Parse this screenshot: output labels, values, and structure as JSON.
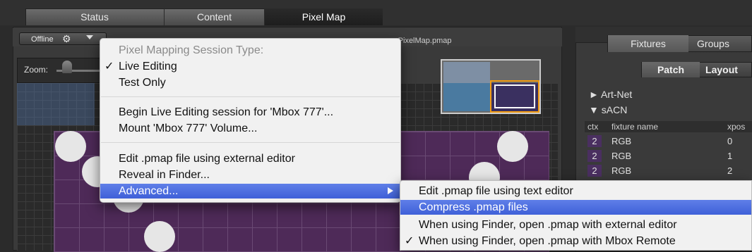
{
  "tabs": [
    {
      "label": "Status"
    },
    {
      "label": "Content"
    },
    {
      "label": "Pixel Map"
    }
  ],
  "toolbar": {
    "offline_label": "Offline",
    "gear_icon": "gear-icon",
    "filename_fragment": "rPixelMap.pmap"
  },
  "zoom": {
    "label": "Zoom:"
  },
  "right_panel": {
    "tabs": [
      "Fixtures",
      "Groups"
    ],
    "subtabs": [
      "Patch",
      "Layout"
    ],
    "tree": [
      {
        "arrow": "►",
        "label": "Art-Net"
      },
      {
        "arrow": "▼",
        "label": "sACN"
      }
    ],
    "columns": [
      "ctx",
      "fixture name",
      "xpos"
    ],
    "rows": [
      {
        "ctx": "2",
        "name": "RGB",
        "xpos": "0"
      },
      {
        "ctx": "2",
        "name": "RGB",
        "xpos": "1"
      },
      {
        "ctx": "2",
        "name": "RGB",
        "xpos": "2"
      }
    ]
  },
  "menu": {
    "header": "Pixel Mapping Session Type:",
    "items": [
      {
        "label": "Live Editing",
        "checked": "✓"
      },
      {
        "label": "Test Only",
        "checked": ""
      },
      {
        "label": "Begin Live Editing session for 'Mbox 777'..."
      },
      {
        "label": "Mount 'Mbox 777' Volume..."
      },
      {
        "label": "Edit .pmap file using external editor"
      },
      {
        "label": "Reveal in Finder..."
      },
      {
        "label": "Advanced..."
      }
    ]
  },
  "submenu": {
    "items": [
      {
        "label": "Edit .pmap file using text editor",
        "checked": ""
      },
      {
        "label": "Compress .pmap files",
        "checked": ""
      },
      {
        "label": "When using Finder, open .pmap with external editor",
        "checked": ""
      },
      {
        "label": "When using Finder, open .pmap with Mbox Remote",
        "checked": "✓"
      }
    ]
  },
  "colors": {
    "highlight": "#3f60d8",
    "pixel_grid": "#4e2a58",
    "thumb_outline": "#f39c12"
  }
}
